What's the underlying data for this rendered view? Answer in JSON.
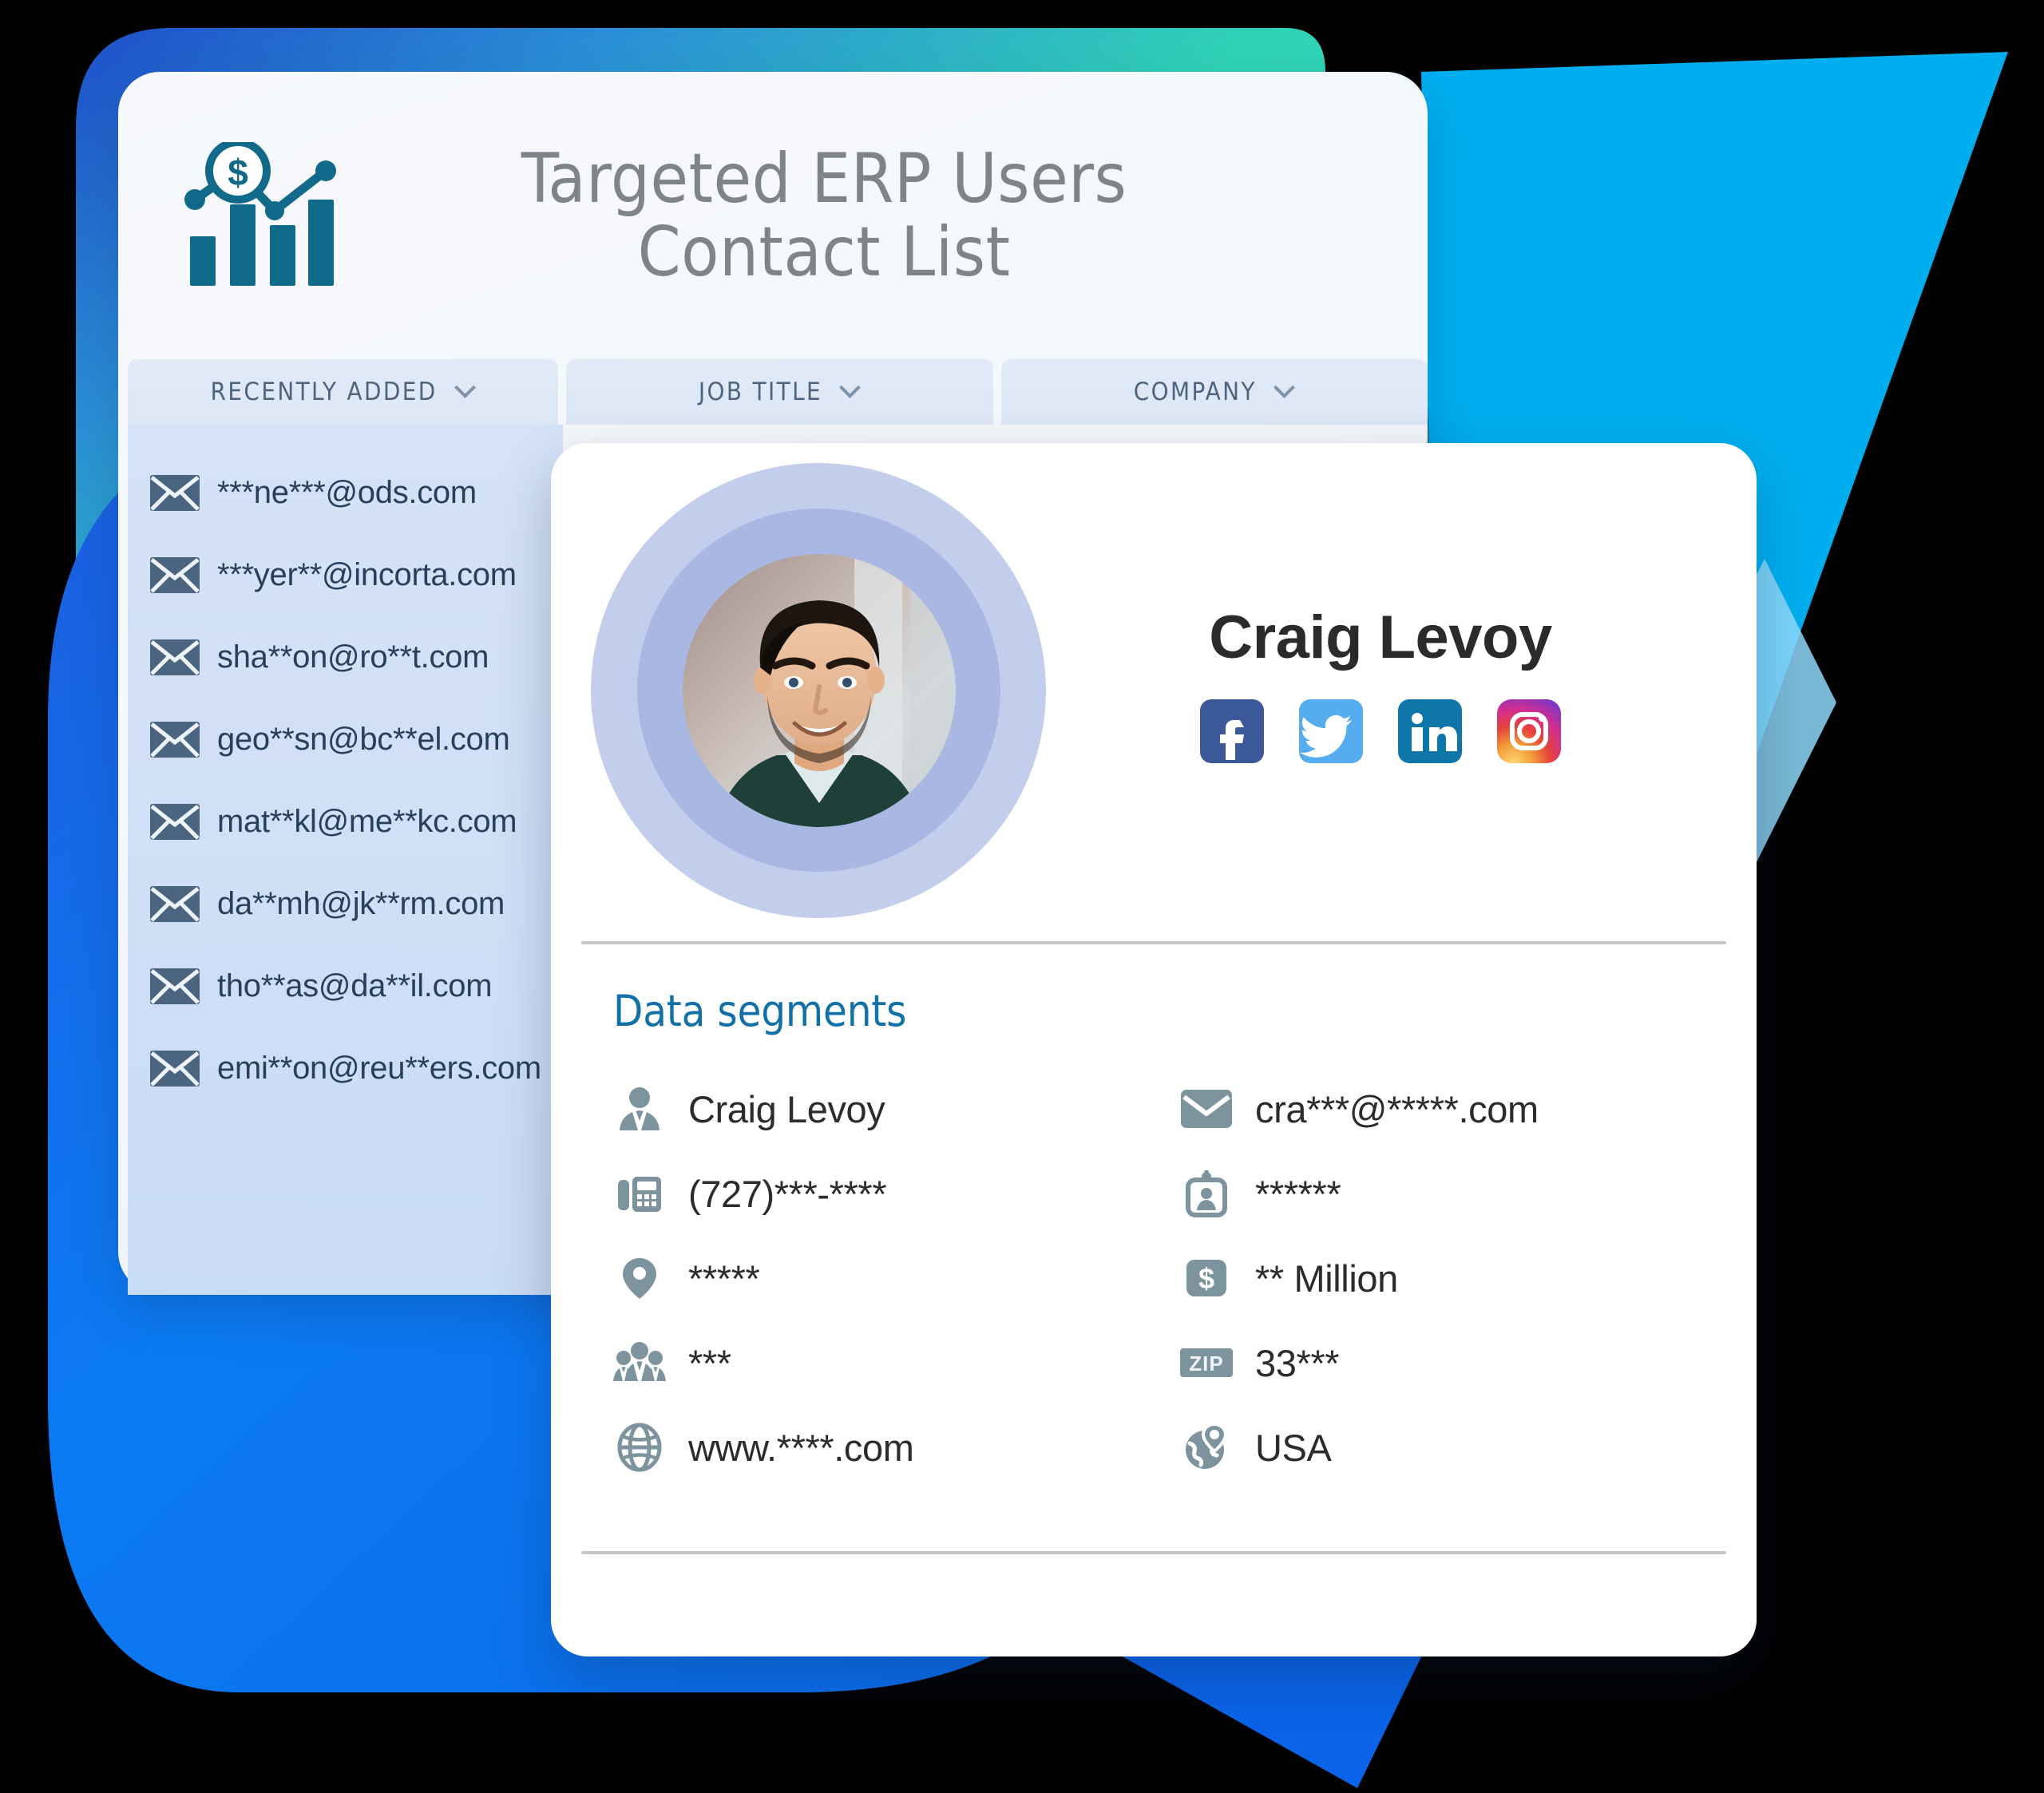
{
  "background": {
    "teal": "#2fd2b8",
    "deep_blue": "#1d4ed8",
    "blue_blob": "#0a74f0",
    "cyan_shape": "#00aeef",
    "light_cyan": "#8fd9fb"
  },
  "list_card": {
    "logo_icon": "bar-chart-dollar-icon",
    "logo_color": "#126a8a",
    "title": "Targeted ERP Users\nContact List",
    "filters": [
      {
        "label": "RECENTLY ADDED",
        "icon": "chevron-down-icon"
      },
      {
        "label": "JOB TITLE",
        "icon": "chevron-down-icon"
      },
      {
        "label": "COMPANY",
        "icon": "chevron-down-icon"
      }
    ],
    "emails": [
      {
        "icon": "envelope-icon",
        "address": "***ne***@ods.com"
      },
      {
        "icon": "envelope-icon",
        "address": "***yer**@incorta.com"
      },
      {
        "icon": "envelope-icon",
        "address": "sha**on@ro**t.com"
      },
      {
        "icon": "envelope-icon",
        "address": "geo**sn@bc**el.com"
      },
      {
        "icon": "envelope-icon",
        "address": "mat**kl@me**kc.com"
      },
      {
        "icon": "envelope-icon",
        "address": "da**mh@jk**rm.com"
      },
      {
        "icon": "envelope-icon",
        "address": "tho**as@da**il.com"
      },
      {
        "icon": "envelope-icon",
        "address": "emi**on@reu**ers.com"
      }
    ]
  },
  "contact_card": {
    "avatar": "profile-photo",
    "name": "Craig Levoy",
    "socials": [
      {
        "name": "facebook-icon",
        "color": "#3b5998"
      },
      {
        "name": "twitter-icon",
        "color": "#55acee"
      },
      {
        "name": "linkedin-icon",
        "color": "#0e76a8"
      },
      {
        "name": "instagram-icon",
        "color": "#dd2a7b"
      }
    ],
    "segments_title": "Data segments",
    "segments_title_color": "#1271a8",
    "icon_color": "#7d939e",
    "segments_left": [
      {
        "icon": "person-silhouette-icon",
        "value": "Craig Levoy"
      },
      {
        "icon": "desk-phone-icon",
        "value": "(727)***-****"
      },
      {
        "icon": "map-pin-icon",
        "value": "*****"
      },
      {
        "icon": "people-group-icon",
        "value": "***"
      },
      {
        "icon": "globe-grid-icon",
        "value": "www.****.com"
      }
    ],
    "segments_right": [
      {
        "icon": "envelope-icon",
        "value": "cra***@*****.com"
      },
      {
        "icon": "id-badge-icon",
        "value": "******"
      },
      {
        "icon": "dollar-box-icon",
        "value": "** Million"
      },
      {
        "icon": "zip-badge-icon",
        "value": "33***"
      },
      {
        "icon": "globe-pin-icon",
        "value": "USA"
      }
    ]
  }
}
